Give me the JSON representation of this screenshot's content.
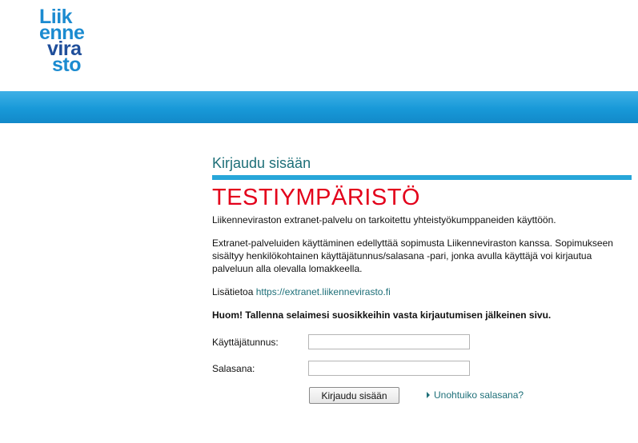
{
  "logo": {
    "line1": "Liik",
    "line2": "enne",
    "line3": "vira",
    "line4": "sto"
  },
  "login": {
    "heading": "Kirjaudu sisään",
    "environment_notice": "TESTIYMPÄRISTÖ",
    "intro": "Liikenneviraston extranet-palvelu on tarkoitettu yhteistyökumppaneiden käyttöön.",
    "agreement": "Extranet-palveluiden käyttäminen edellyttää sopimusta Liikenneviraston kanssa. Sopimukseen sisältyy henkilökohtainen käyttäjätunnus/salasana -pari, jonka avulla käyttäjä voi kirjautua palveluun alla olevalla lomakkeella.",
    "more_info_label": "Lisätietoa",
    "more_info_link": "https://extranet.liikennevirasto.fi",
    "bookmark_note": "Huom! Tallenna selaimesi suosikkeihin vasta kirjautumisen jälkeinen sivu.",
    "username_label": "Käyttäjätunnus:",
    "username_value": "",
    "password_label": "Salasana:",
    "password_value": "",
    "submit_label": "Kirjaudu sisään",
    "forgot_label": "Unohtuiko salasana?"
  },
  "colors": {
    "banner": "#1899d8",
    "heading": "#1d6f78",
    "notice": "#e3001b",
    "rule": "#27a6d9"
  }
}
